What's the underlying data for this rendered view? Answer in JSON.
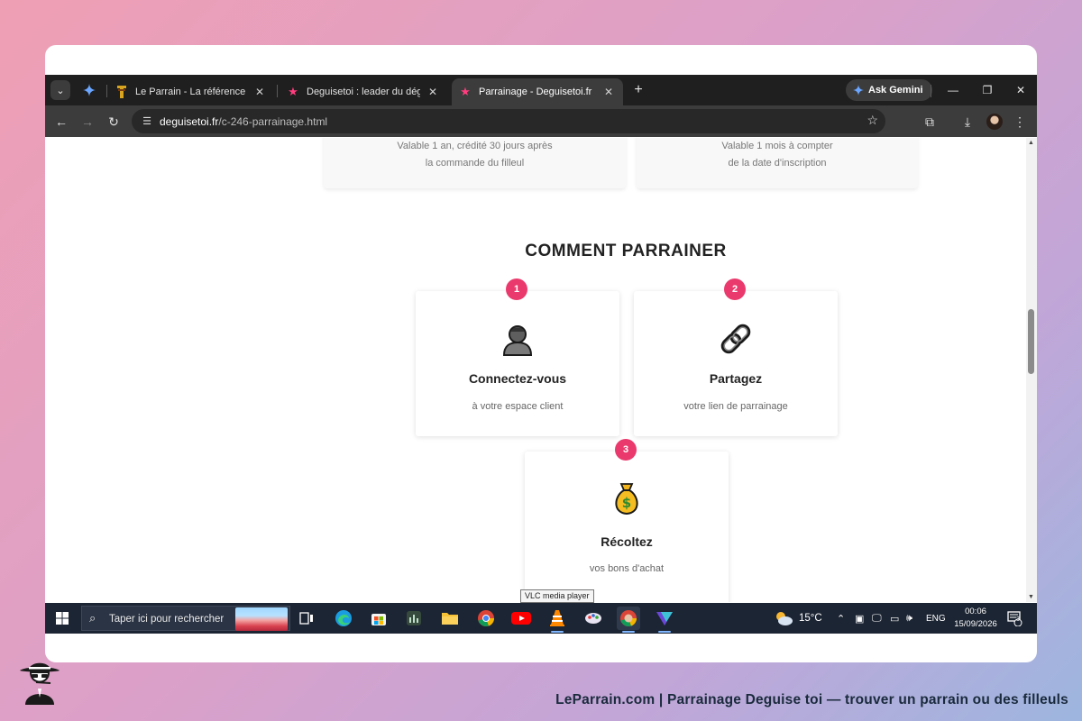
{
  "browser": {
    "tabs": [
      {
        "title": "Le Parrain - La référence du parrainage",
        "active": false
      },
      {
        "title": "Deguisetoi : leader du déguisement",
        "active": false
      },
      {
        "title": "Parrainage - Deguisetoi.fr",
        "active": true
      }
    ],
    "ask_gemini_label": "Ask Gemini",
    "url_domain": "deguisetoi.fr",
    "url_path": "/c-246-parrainage.html"
  },
  "page": {
    "top_cards": [
      {
        "line1": "Valable 1 an, crédité 30 jours après",
        "line2": "la commande du filleul"
      },
      {
        "line1": "Valable 1 mois à compter",
        "line2": "de la date d'inscription"
      }
    ],
    "heading": "COMMENT PARRAINER",
    "steps": [
      {
        "number": "1",
        "icon": "person-icon",
        "title": "Connectez-vous",
        "description": "à votre espace client"
      },
      {
        "number": "2",
        "icon": "link-icon",
        "title": "Partagez",
        "description": "votre lien de parrainage"
      },
      {
        "number": "3",
        "icon": "money-bag-icon",
        "title": "Récoltez",
        "description": "vos bons d'achat"
      }
    ],
    "accent_color": "#ea3a6d"
  },
  "taskbar": {
    "search_placeholder": "Taper ici pour rechercher",
    "tooltip": "VLC media player",
    "weather": "15°C",
    "language": "ENG",
    "time": "00:06",
    "date": "15/09/2026",
    "notifications": "3"
  },
  "footer": {
    "caption": "LeParrain.com | Parrainage Deguise toi — trouver un parrain ou des filleuls"
  }
}
